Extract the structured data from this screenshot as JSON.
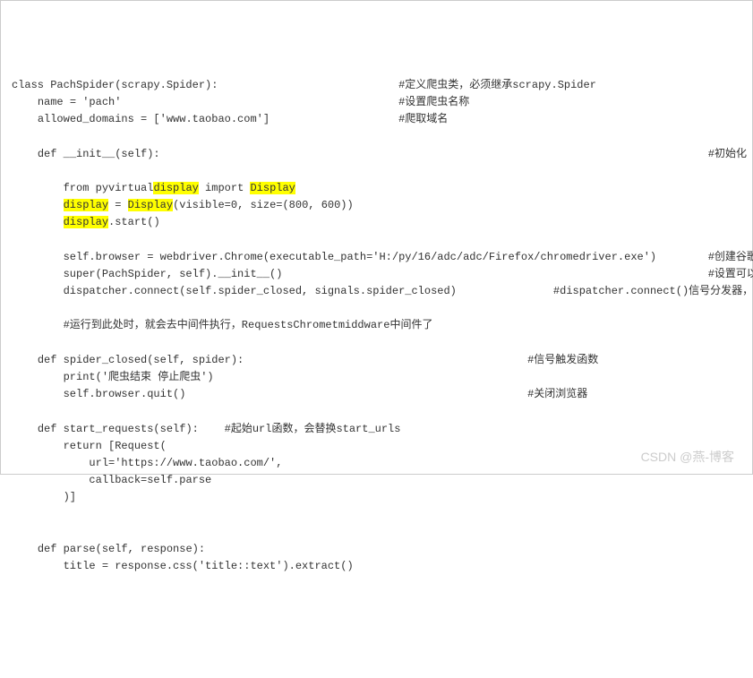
{
  "code": {
    "lines": [
      {
        "indent": 0,
        "seg": [
          {
            "t": "class PachSpider(scrapy.Spider):"
          }
        ],
        "comment": "#定义爬虫类，必须继承scrapy.Spider",
        "comment_col": 60
      },
      {
        "indent": 1,
        "seg": [
          {
            "t": "name = 'pach'"
          }
        ],
        "comment": "#设置爬虫名称",
        "comment_col": 60
      },
      {
        "indent": 1,
        "seg": [
          {
            "t": "allowed_domains = ['www.taobao.com']"
          }
        ],
        "comment": "#爬取域名",
        "comment_col": 60
      },
      {
        "indent": 0,
        "seg": []
      },
      {
        "indent": 1,
        "seg": [
          {
            "t": "def __init__(self):"
          }
        ],
        "comment": "#初始化",
        "comment_col": 108
      },
      {
        "indent": 0,
        "seg": []
      },
      {
        "indent": 2,
        "seg": [
          {
            "t": "from pyvirtual"
          },
          {
            "t": "display",
            "hl": true
          },
          {
            "t": " import "
          },
          {
            "t": "Display",
            "hl": true
          }
        ]
      },
      {
        "indent": 2,
        "seg": [
          {
            "t": "display",
            "hl": true
          },
          {
            "t": " = "
          },
          {
            "t": "Display",
            "hl": true
          },
          {
            "t": "(visible=0, size=(800, 600))"
          }
        ]
      },
      {
        "indent": 2,
        "seg": [
          {
            "t": "display",
            "hl": true
          },
          {
            "t": ".start()"
          }
        ]
      },
      {
        "indent": 0,
        "seg": []
      },
      {
        "indent": 2,
        "seg": [
          {
            "t": "self.browser = webdriver.Chrome(executable_path='H:/py/16/adc/adc/Firefox/chromedriver.exe')"
          }
        ],
        "comment": "#创建谷歌",
        "comment_col": 108
      },
      {
        "indent": 2,
        "seg": [
          {
            "t": "super(PachSpider, self).__init__()"
          }
        ],
        "comment": "#设置可以",
        "comment_col": 108
      },
      {
        "indent": 2,
        "seg": [
          {
            "t": "dispatcher.connect(self.spider_closed, signals.spider_closed)"
          }
        ],
        "comment": "#dispatcher.connect()信号分发器，第一",
        "comment_col": 84
      },
      {
        "indent": 0,
        "seg": []
      },
      {
        "indent": 2,
        "seg": [
          {
            "t": "#运行到此处时，就会去中间件执行，RequestsChrometmiddware中间件了"
          }
        ]
      },
      {
        "indent": 0,
        "seg": []
      },
      {
        "indent": 1,
        "seg": [
          {
            "t": "def spider_closed(self, spider):"
          }
        ],
        "comment": "#信号触发函数",
        "comment_col": 80
      },
      {
        "indent": 2,
        "seg": [
          {
            "t": "print('爬虫结束 停止爬虫')"
          }
        ]
      },
      {
        "indent": 2,
        "seg": [
          {
            "t": "self.browser.quit()"
          }
        ],
        "comment": "#关闭浏览器",
        "comment_col": 80
      },
      {
        "indent": 0,
        "seg": []
      },
      {
        "indent": 1,
        "seg": [
          {
            "t": "def start_requests(self):    #起始url函数，会替换start_urls"
          }
        ]
      },
      {
        "indent": 2,
        "seg": [
          {
            "t": "return [Request("
          }
        ]
      },
      {
        "indent": 3,
        "seg": [
          {
            "t": "url='https://www.taobao.com/',"
          }
        ]
      },
      {
        "indent": 3,
        "seg": [
          {
            "t": "callback=self.parse"
          }
        ]
      },
      {
        "indent": 2,
        "seg": [
          {
            "t": ")]"
          }
        ]
      },
      {
        "indent": 0,
        "seg": []
      },
      {
        "indent": 0,
        "seg": []
      },
      {
        "indent": 1,
        "seg": [
          {
            "t": "def parse(self, response):"
          }
        ]
      },
      {
        "indent": 2,
        "seg": [
          {
            "t": "title = response.css('title::text').extract()"
          }
        ]
      }
    ]
  },
  "watermark": "CSDN @燕-博客"
}
